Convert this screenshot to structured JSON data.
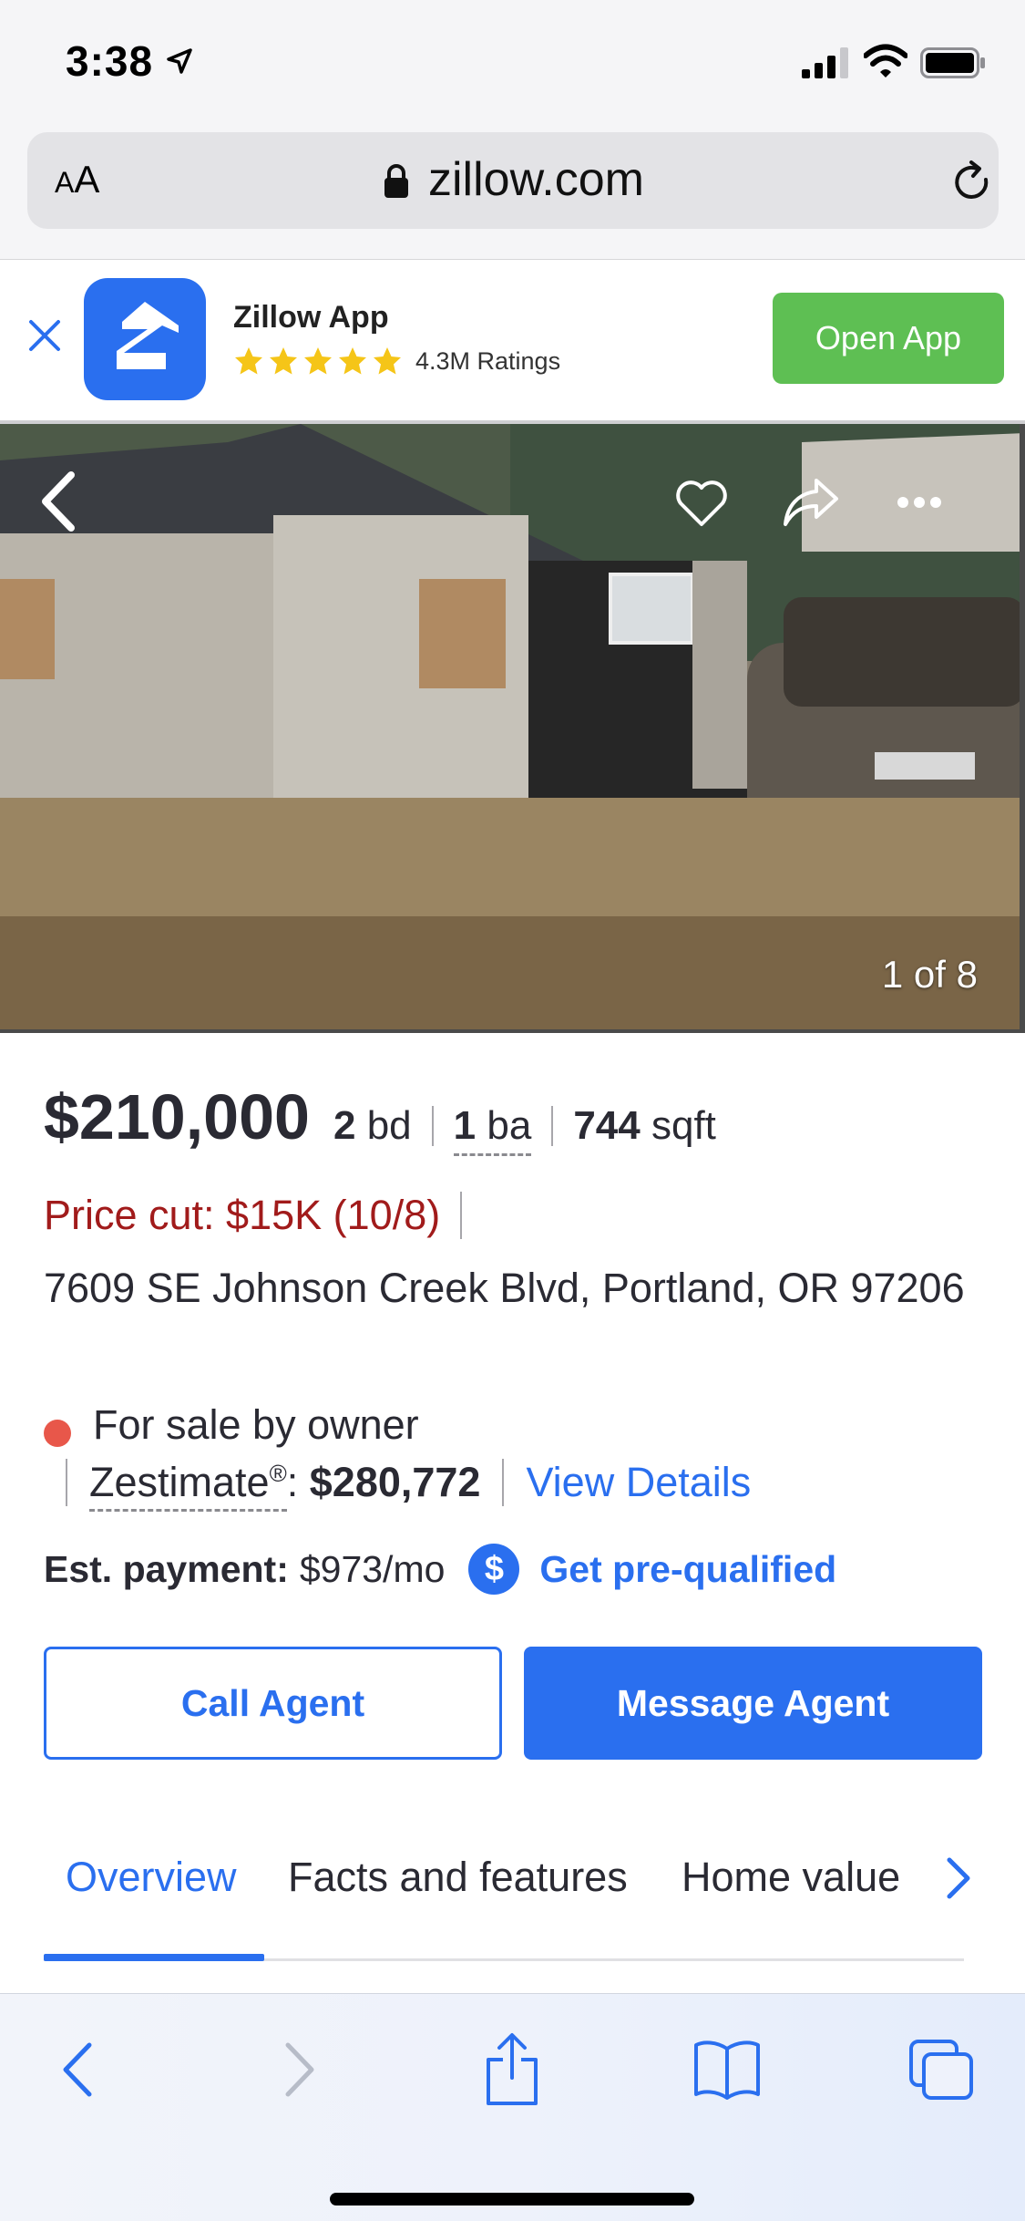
{
  "status_bar": {
    "time": "3:38"
  },
  "browser": {
    "text_size_label_small": "A",
    "text_size_label_large": "A",
    "url": "zillow.com"
  },
  "app_banner": {
    "app_name": "Zillow App",
    "ratings": "4.3M Ratings",
    "stars": 5,
    "open_label": "Open App",
    "colors": {
      "open_button": "#5ebf53",
      "icon_bg": "#2a6fef",
      "stars": "#f5c518"
    }
  },
  "photo": {
    "counter": "1 of 8"
  },
  "listing": {
    "price": "$210,000",
    "beds_num": "2",
    "beds_unit": "bd",
    "baths_num": "1",
    "baths_unit": "ba",
    "sqft_num": "744",
    "sqft_unit": "sqft",
    "price_cut": "Price cut: $15K (10/8)",
    "address": "7609 SE Johnson Creek Blvd, Portland, OR 97206",
    "status": "For sale by owner",
    "zestimate_label": "Zestimate",
    "zestimate_mark": "®",
    "zestimate_colon": ":",
    "zestimate_value": "$280,772",
    "view_details": "View Details",
    "est_payment_label": "Est. payment:",
    "est_payment_value": "$973/mo",
    "dollar_icon": "$",
    "prequalified": "Get pre-qualified"
  },
  "actions": {
    "call_agent": "Call Agent",
    "message_agent": "Message Agent"
  },
  "tabs": [
    {
      "label": "Overview",
      "active": true
    },
    {
      "label": "Facts and features",
      "active": false
    },
    {
      "label": "Home value",
      "active": false
    }
  ],
  "colors": {
    "accent": "#2a6fef",
    "price_cut": "#a11b1b",
    "status_dot": "#e8574a"
  }
}
